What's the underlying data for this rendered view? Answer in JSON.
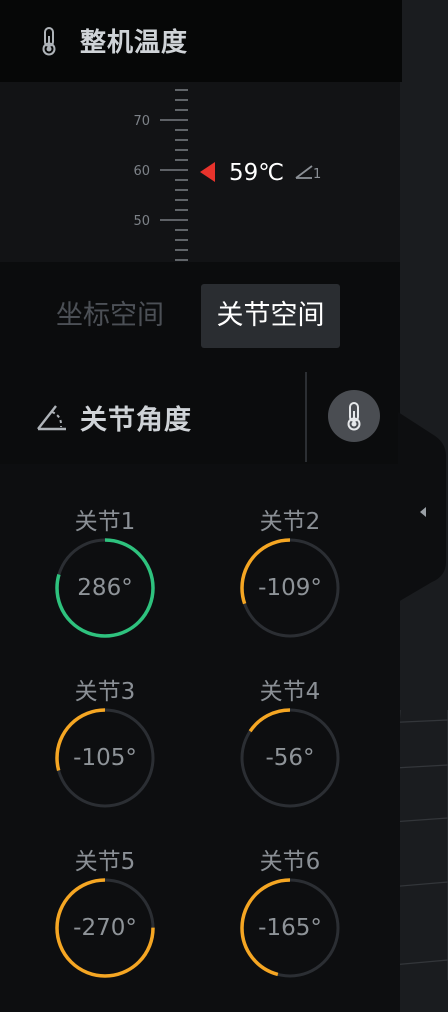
{
  "header": {
    "title": "整机温度",
    "icon": "thermometer-icon"
  },
  "thermometer": {
    "ticks": [
      "70",
      "60",
      "50"
    ],
    "reading": "59℃",
    "marker_color": "#e8332c",
    "sub_index": "1"
  },
  "tabs": [
    {
      "label": "坐标空间",
      "active": false
    },
    {
      "label": "关节空间",
      "active": true
    }
  ],
  "section": {
    "title": "关节角度",
    "icon": "angle-icon",
    "action_icon": "thermometer-icon"
  },
  "joints": [
    {
      "label": "关节1",
      "value": "286°",
      "angle": 286,
      "color": "#2ec27e"
    },
    {
      "label": "关节2",
      "value": "-109°",
      "angle": -109,
      "color": "#f5a623"
    },
    {
      "label": "关节3",
      "value": "-105°",
      "angle": -105,
      "color": "#f5a623"
    },
    {
      "label": "关节4",
      "value": "-56°",
      "angle": -56,
      "color": "#f5a623"
    },
    {
      "label": "关节5",
      "value": "-270°",
      "angle": -270,
      "color": "#f5a623"
    },
    {
      "label": "关节6",
      "value": "-165°",
      "angle": -165,
      "color": "#f5a623"
    }
  ],
  "colors": {
    "ring_track": "#2b2e33",
    "panel_bg": "#0d0e10",
    "active_tab_bg": "#2a2d31"
  }
}
